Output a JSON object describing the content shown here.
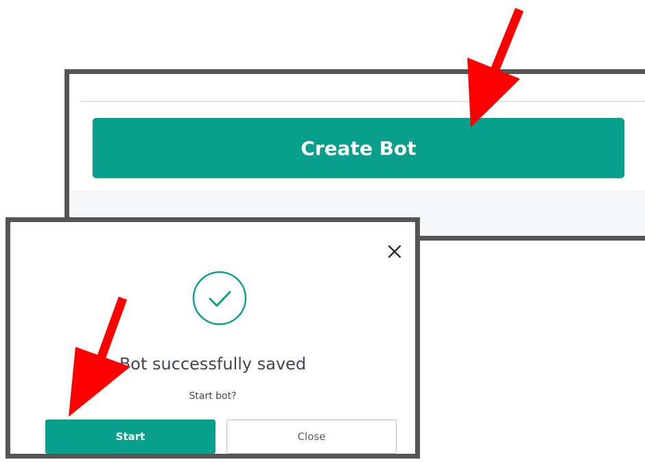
{
  "top_panel": {
    "create_bot_label": "Create Bot"
  },
  "dialog": {
    "title": "Bot successfully saved",
    "prompt": "Start bot?",
    "start_label": "Start",
    "close_label": "Close",
    "close_icon": "close-icon",
    "status_icon": "checkmark-circle-icon"
  },
  "annotations": {
    "arrow_icon": "red-arrow-icon",
    "arrow_color": "#ff0000"
  },
  "colors": {
    "accent": "#08a08c",
    "frame": "#555555",
    "text": "#3f4650"
  }
}
